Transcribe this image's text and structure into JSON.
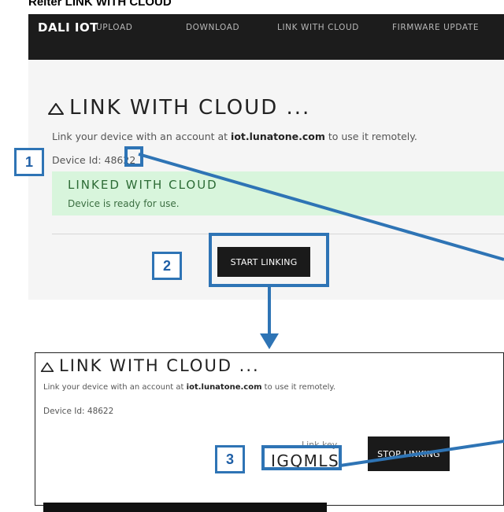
{
  "document": {
    "heading": "Reiter LINK WITH CLOUD"
  },
  "navbar": {
    "brand": "DALI IOT",
    "items": [
      "UPLOAD",
      "DOWNLOAD",
      "LINK WITH CLOUD",
      "FIRMWARE UPDATE"
    ]
  },
  "panel1": {
    "title": "LINK WITH CLOUD ...",
    "desc_before": "Link your device with an account at ",
    "desc_domain": "iot.lunatone.com",
    "desc_after": " to use it remotely.",
    "device_id_label": "Device Id: ",
    "device_id_value": "48622",
    "status_title": "LINKED WITH CLOUD",
    "status_message": "Device is ready for use.",
    "button_label": "START LINKING"
  },
  "panel2": {
    "title": "LINK WITH CLOUD ...",
    "desc_before": "Link your device with an account at ",
    "desc_domain": "iot.lunatone.com",
    "desc_after": " to use it remotely.",
    "device_id_text": "Device Id: 48622",
    "link_key_label": "Link key",
    "link_key_value": "IGQMLS",
    "button_label": "STOP LINKING"
  },
  "callouts": [
    "1",
    "2",
    "3"
  ],
  "colors": {
    "accent": "#2e74b5",
    "navbar": "#1c1c1c",
    "success_bg": "#d8f5dc",
    "success_text": "#2c6b35"
  }
}
